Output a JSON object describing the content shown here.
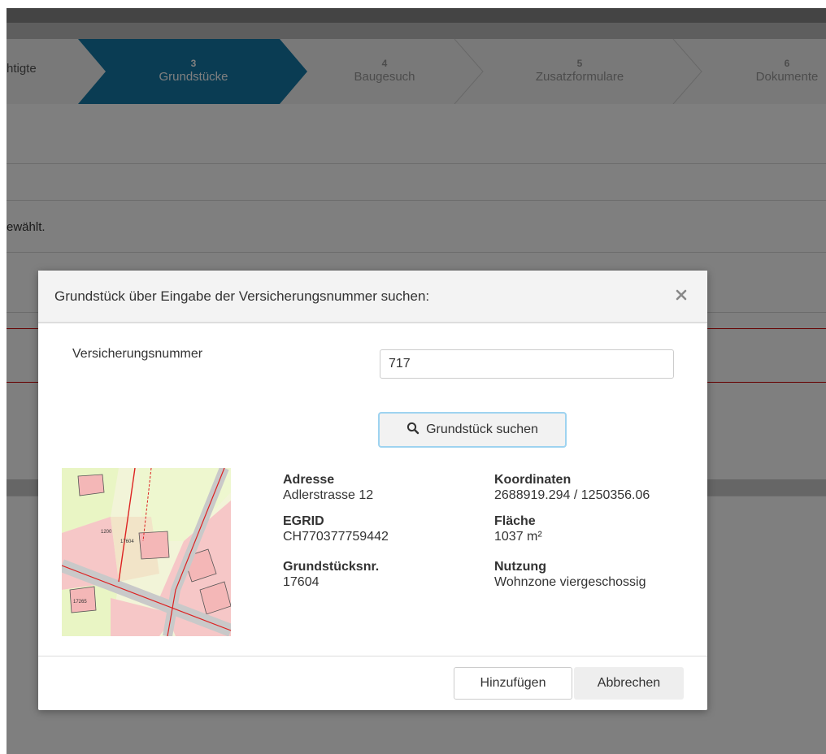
{
  "wizard": {
    "steps": [
      {
        "num": "",
        "label": "htigte"
      },
      {
        "num": "3",
        "label": "Grundstücke"
      },
      {
        "num": "4",
        "label": "Baugesuch"
      },
      {
        "num": "5",
        "label": "Zusatzformulare"
      },
      {
        "num": "6",
        "label": "Dokumente"
      }
    ],
    "active_step": "3"
  },
  "background": {
    "notice_fragment": "ewählt."
  },
  "colors": {
    "active_step": "#1479a7",
    "overlay": "#000000",
    "search_button_border": "#9ed3f0",
    "accent_line": "#cc0000"
  },
  "modal": {
    "title": "Grundstück über Eingabe der Versicherungsnummer suchen:",
    "close_icon": "close-icon",
    "field": {
      "label": "Versicherungsnummer",
      "value": "717",
      "placeholder": ""
    },
    "search_button": {
      "icon": "search-icon",
      "label": "Grundstück suchen"
    },
    "result": {
      "map_icon": "cadastral-map-thumbnail",
      "left": [
        {
          "key": "Adresse",
          "value": "Adlerstrasse 12"
        },
        {
          "key": "EGRID",
          "value": "CH770377759442"
        },
        {
          "key": "Grundstücksnr.",
          "value": "17604"
        }
      ],
      "right": [
        {
          "key": "Koordinaten",
          "value": "2688919.294 / 1250356.06"
        },
        {
          "key": "Fläche",
          "value": "1037 m²"
        },
        {
          "key": "Nutzung",
          "value": "Wohnzone viergeschossig"
        }
      ],
      "map_labels": [
        "1200",
        "17604",
        "17265"
      ]
    },
    "footer": {
      "add_label": "Hinzufügen",
      "cancel_label": "Abbrechen"
    }
  }
}
